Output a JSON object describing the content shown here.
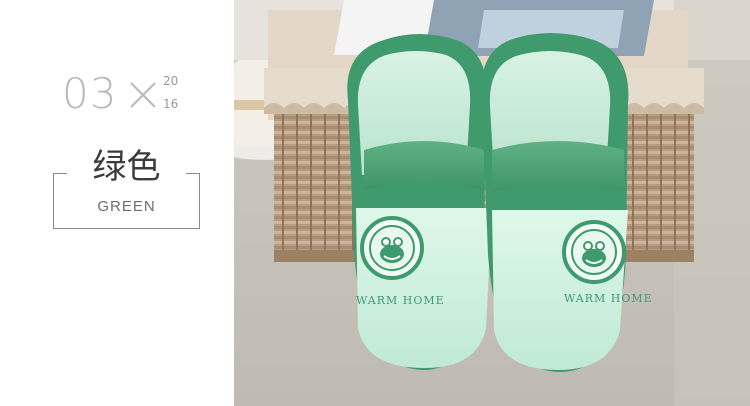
{
  "color_label": {
    "number": "03",
    "year_top": "20",
    "year_bottom": "16",
    "name_cn": "绿色",
    "name_en": "GREEN"
  },
  "product": {
    "slipper_text": "WARM HOME",
    "badge_icon": "frog-face-icon"
  },
  "colors": {
    "accent_green": "#4fa77a",
    "light_green": "#c9efdc",
    "label_gray": "#b9b9b9"
  }
}
